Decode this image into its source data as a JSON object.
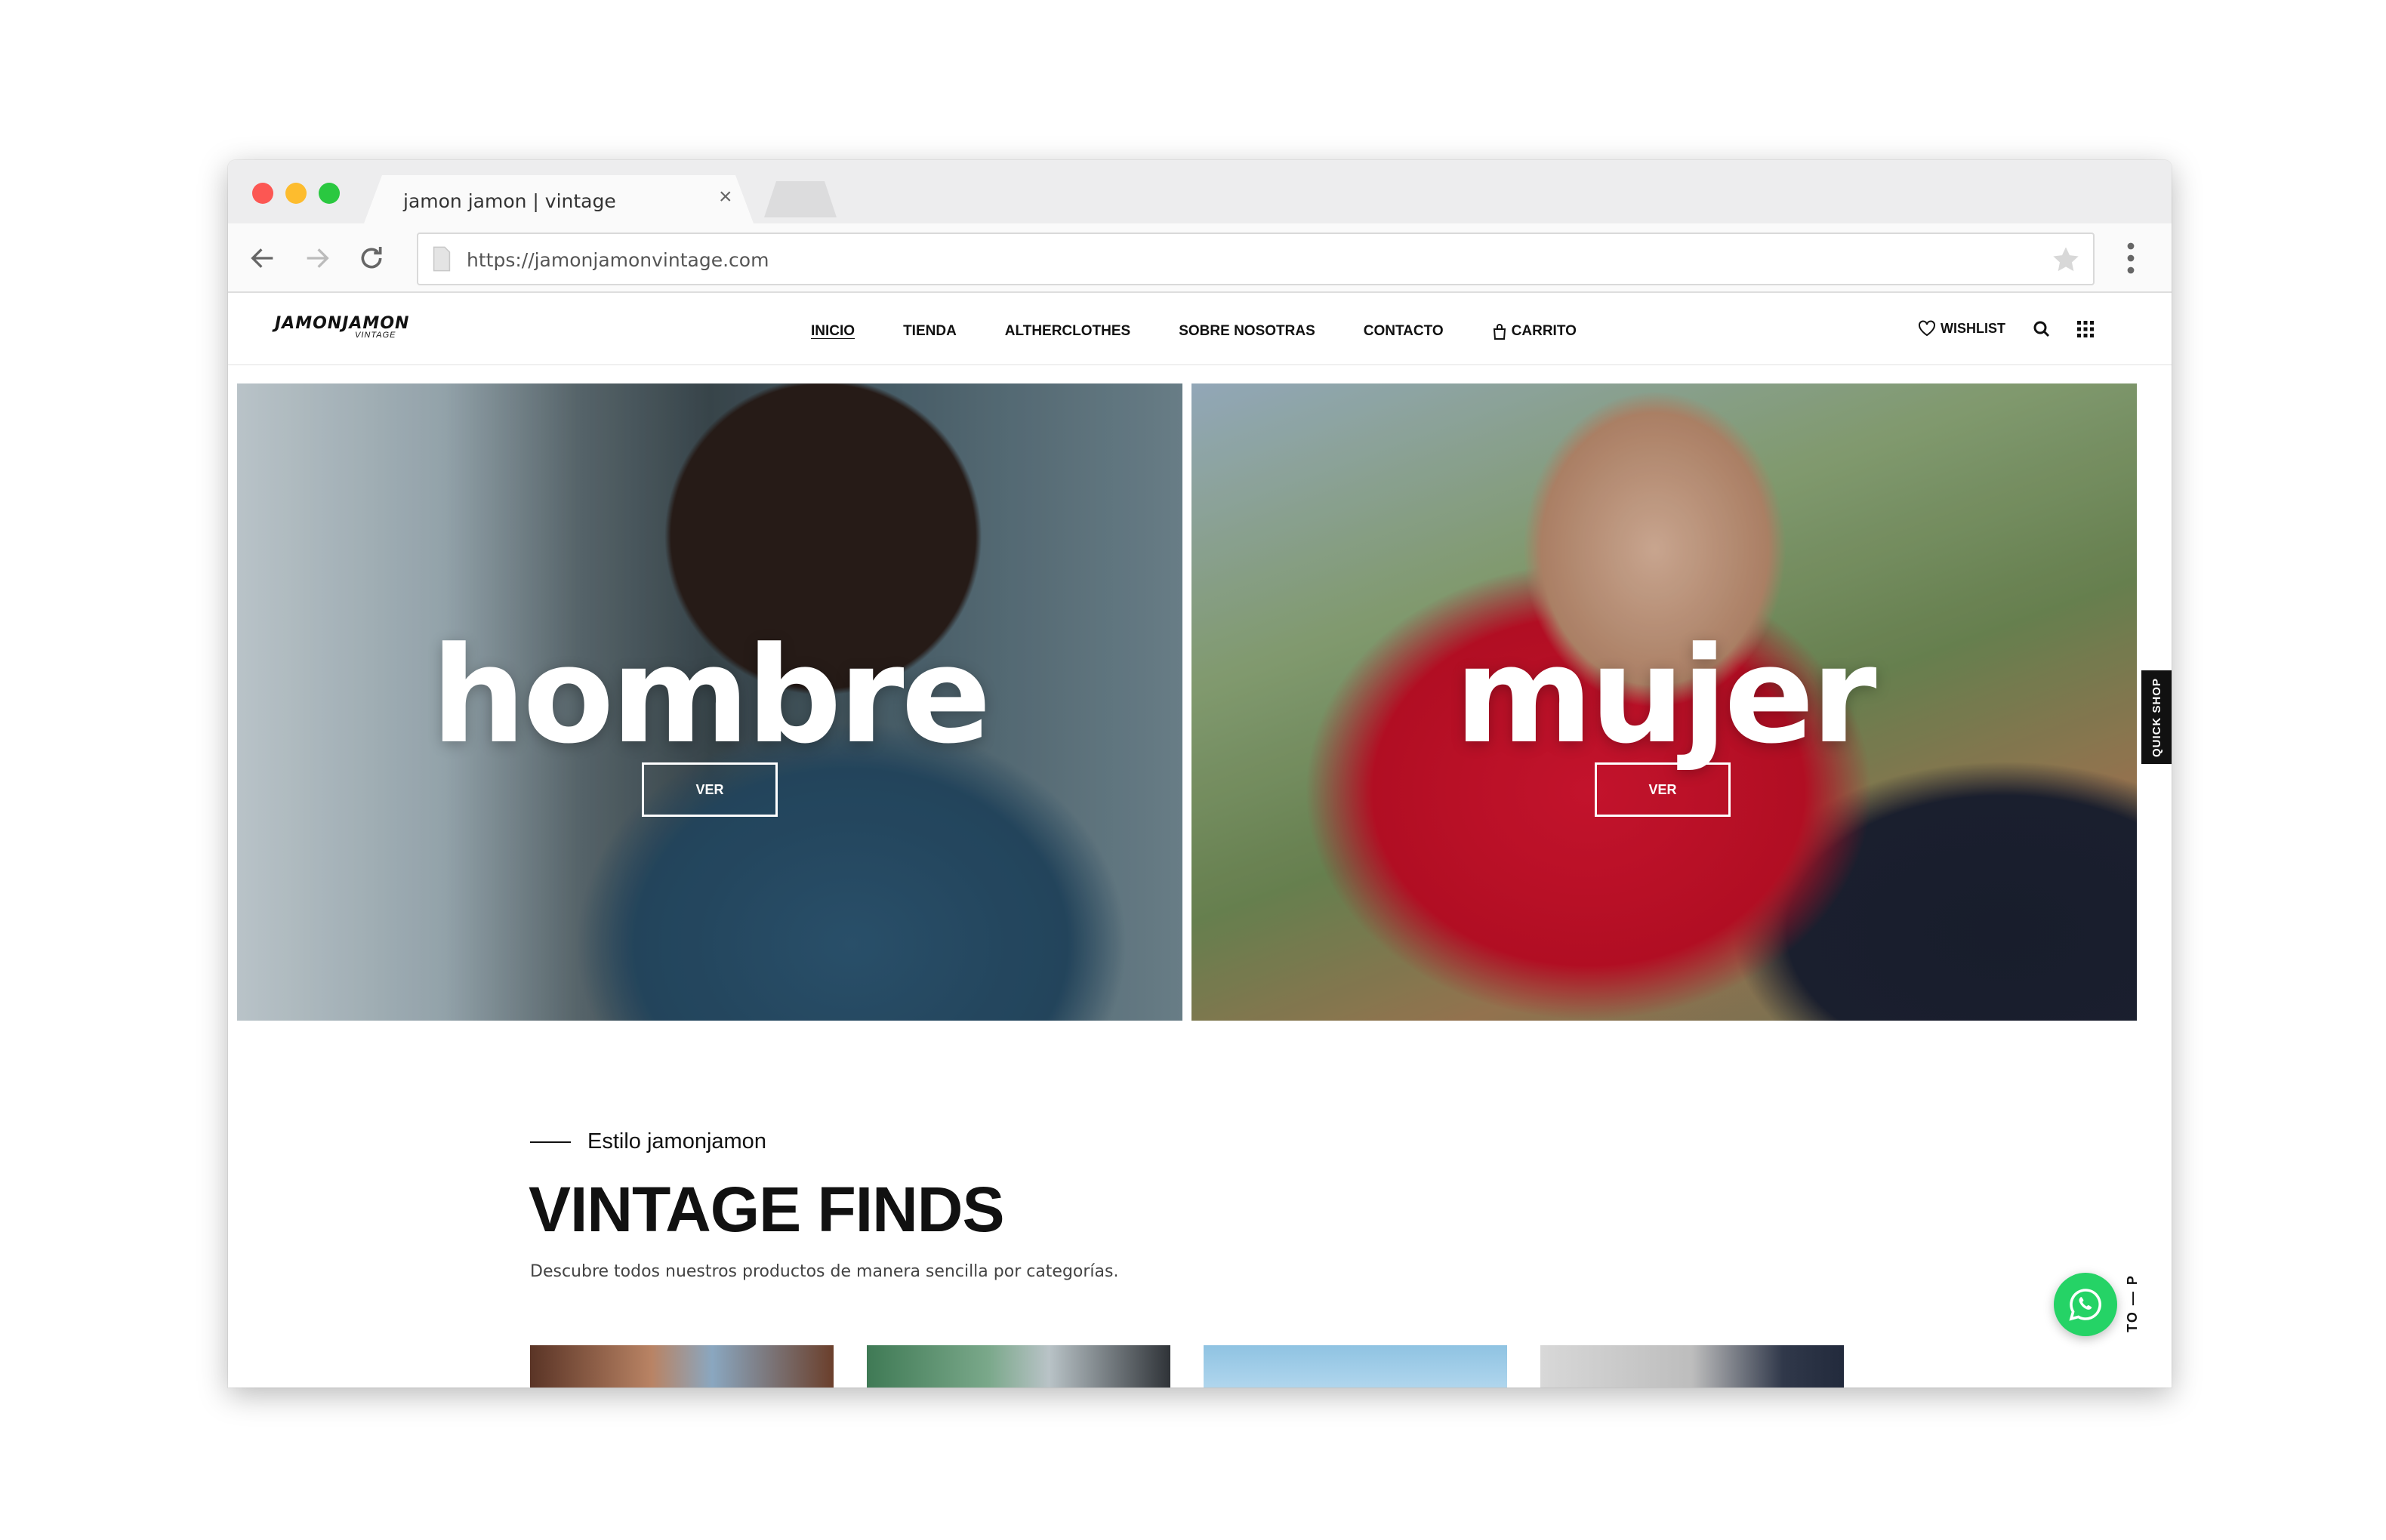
{
  "browser": {
    "tab_title": "jamon jamon | vintage",
    "url": "https://jamonjamonvintage.com"
  },
  "site": {
    "logo_main": "JAMONJAMON",
    "logo_sub": "VINTAGE",
    "nav": [
      {
        "label": "INICIO",
        "active": true
      },
      {
        "label": "TIENDA"
      },
      {
        "label": "ALTHERCLOTHES"
      },
      {
        "label": "SOBRE NOSOTRAS"
      },
      {
        "label": "CONTACTO"
      },
      {
        "label": "CARRITO",
        "icon": "bag-icon"
      }
    ],
    "wishlist_label": "WISHLIST",
    "hero": [
      {
        "title": "hombre",
        "button": "VER"
      },
      {
        "title": "mujer",
        "button": "VER"
      }
    ],
    "quick_shop": "QUICK SHOP",
    "section": {
      "kicker": "Estilo jamonjamon",
      "title": "VINTAGE FINDS",
      "description": "Descubre todos nuestros productos de manera sencilla por categorías."
    },
    "to_top": "TO — P"
  },
  "colors": {
    "whatsapp": "#25d366",
    "traffic_red": "#fc5753",
    "traffic_yellow": "#fdbc2e",
    "traffic_green": "#2ac840"
  }
}
